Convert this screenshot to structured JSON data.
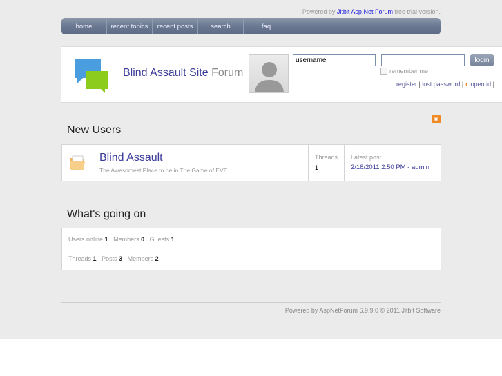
{
  "powered": {
    "prefix": "Powered by",
    "link": "Jitbit Asp.Net Forum",
    "suffix": "free trial version."
  },
  "nav": [
    "home",
    "recent topics",
    "recent posts",
    "search",
    "faq"
  ],
  "header": {
    "site": "Blind Assault Site",
    "forum": "Forum",
    "username_value": "username",
    "password_value": "",
    "login": "login",
    "remember": "remember me",
    "register": "register",
    "lost_password": "lost password",
    "open_id": "open id"
  },
  "sections": {
    "new_users": "New Users",
    "whats_going_on": "What's going on"
  },
  "forum": {
    "title": "Blind Assault",
    "description": "The Awesomest Place to be in The Game of EVE.",
    "threads_label": "Threads",
    "threads": "1",
    "latest_label": "Latest post",
    "latest_date": "2/18/2011 2:50 PM",
    "latest_author": "admin"
  },
  "stats": {
    "users_online_label": "Users online",
    "users_online": "1",
    "members_online_label": "Members",
    "members_online": "0",
    "guests_label": "Guests",
    "guests": "1",
    "threads_label": "Threads",
    "threads": "1",
    "posts_label": "Posts",
    "posts": "3",
    "members_label": "Members",
    "members": "2"
  },
  "footer": "Powered by AspNetForum 6.9.9.0 © 2011 Jitbit Software"
}
